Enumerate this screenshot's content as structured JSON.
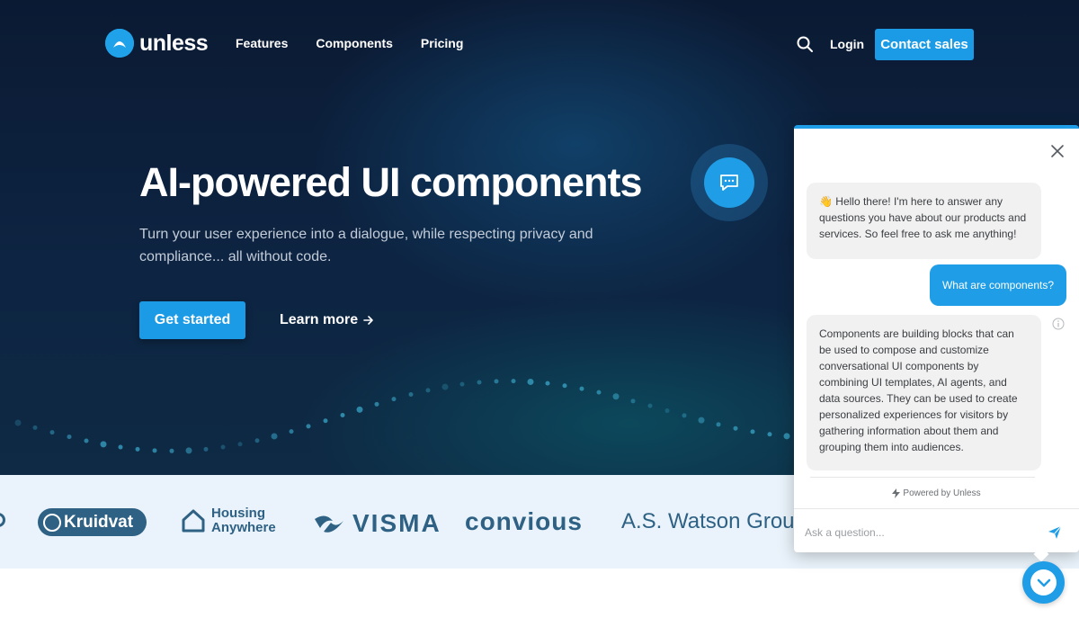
{
  "brand": {
    "name": "unless",
    "accent": "#1b9be6",
    "hero_bg": "#0b1a33"
  },
  "nav": {
    "items": [
      "Features",
      "Components",
      "Pricing"
    ],
    "login": "Login",
    "contact": "Contact sales"
  },
  "hero": {
    "headline": "AI-powered UI components",
    "subtitle": "Turn your user experience into a dialogue, while respecting privacy and compliance... all without code.",
    "primary_cta": "Get started",
    "secondary_cta": "Learn more"
  },
  "logos": {
    "kruidvat": "Kruidvat",
    "housing_line1": "Housing",
    "housing_line2": "Anywhere",
    "visma": "VISMA",
    "convious": "convious",
    "watson": "A.S. Watson Group"
  },
  "chat": {
    "greeting": "👋 Hello there! I'm here to answer any questions you have about our products and services. So feel free to ask me anything!",
    "user_message": "What are components?",
    "bot_answer": "Components are building blocks that can be used to compose and customize conversational UI components by combining UI templates, AI agents, and data sources. They can be used to create personalized experiences for visitors by gathering information about them and grouping them into audiences.",
    "powered_by": "Powered by Unless",
    "input_placeholder": "Ask a question..."
  },
  "icons": {
    "search": "search-icon",
    "chat": "chat-bubble-icon",
    "arrow": "arrow-right-icon",
    "close": "close-icon",
    "info": "info-icon",
    "bolt": "bolt-icon",
    "send": "send-icon",
    "launcher": "chevron-down-icon"
  }
}
